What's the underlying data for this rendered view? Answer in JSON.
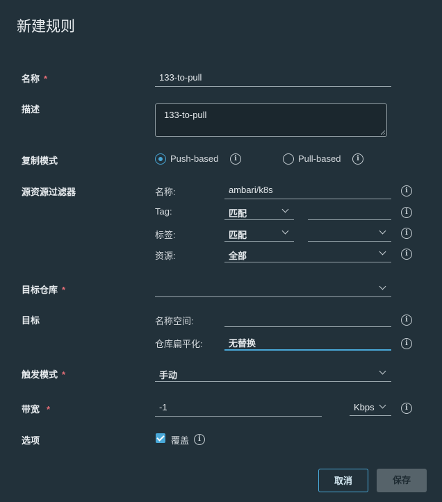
{
  "dialog": {
    "title": "新建规则"
  },
  "form": {
    "name": {
      "label": "名称",
      "required_mark": "*",
      "value": "133-to-pull"
    },
    "description": {
      "label": "描述",
      "value": "133-to-pull"
    },
    "replication_mode": {
      "label": "复制模式",
      "options": [
        {
          "label": "Push-based",
          "selected": true
        },
        {
          "label": "Pull-based",
          "selected": false
        }
      ]
    },
    "source_filter": {
      "label": "源资源过滤器",
      "name_label": "名称:",
      "name_value": "ambari/k8s",
      "tag_label": "Tag:",
      "tag_match": "匹配",
      "tag_value": "",
      "labels_label": "标签:",
      "labels_match": "匹配",
      "labels_value": "",
      "resource_label": "资源:",
      "resource_value": "全部"
    },
    "target_registry": {
      "label": "目标仓库",
      "required_mark": "*",
      "value": ""
    },
    "target": {
      "label": "目标",
      "namespace_label": "名称空间:",
      "namespace_value": "",
      "flatten_label": "仓库扁平化:",
      "flatten_value": "无替换"
    },
    "trigger_mode": {
      "label": "触发模式",
      "required_mark": "*",
      "value": "手动"
    },
    "bandwidth": {
      "label": "带宽",
      "required_mark": "*",
      "value": "-1",
      "unit": "Kbps"
    },
    "options": {
      "label": "选项",
      "override_label": "覆盖",
      "override_checked": true
    }
  },
  "buttons": {
    "cancel": "取消",
    "save": "保存"
  },
  "colors": {
    "accent": "#49a8d8",
    "required": "#e06c75",
    "background": "#22313a"
  }
}
